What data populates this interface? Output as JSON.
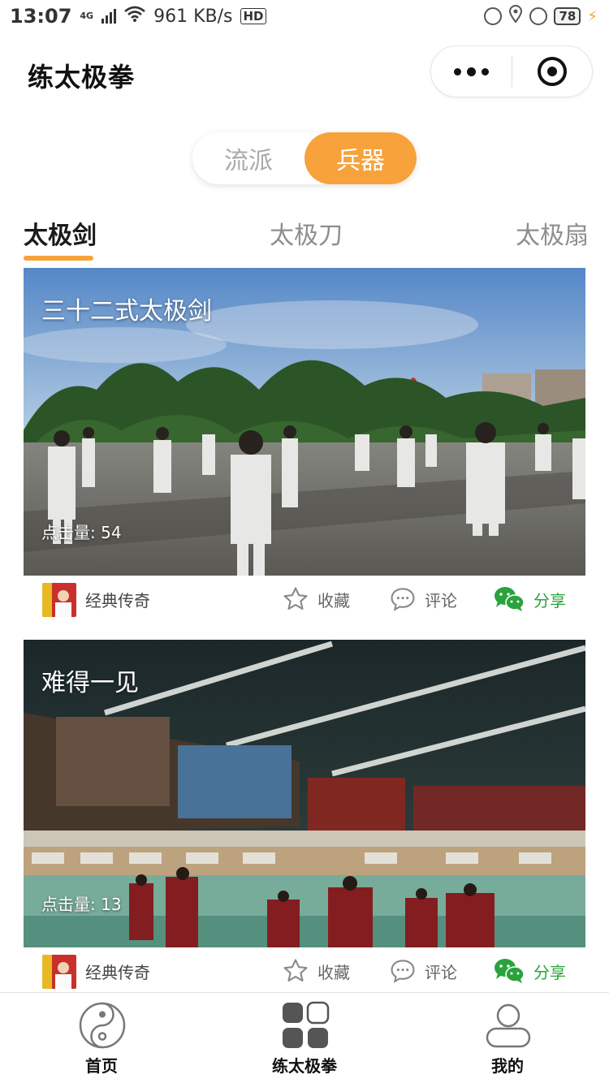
{
  "status_bar": {
    "time": "13:07",
    "network_type": "4G",
    "speed": "961 KB/s",
    "hd": "HD",
    "battery": "78"
  },
  "nav": {
    "title": "练太极拳"
  },
  "segment": {
    "options": [
      "流派",
      "兵器"
    ],
    "active_index": 1
  },
  "category_tabs": {
    "items": [
      "太极剑",
      "太极刀",
      "太极扇"
    ],
    "active_index": 0
  },
  "videos": [
    {
      "title": "三十二式太极剑",
      "clicks": "点击量: 54",
      "author": "经典传奇",
      "collect_label": "收藏",
      "comment_label": "评论",
      "share_label": "分享"
    },
    {
      "title": "难得一见",
      "clicks": "点击量: 13",
      "author": "经典传奇",
      "collect_label": "收藏",
      "comment_label": "评论",
      "share_label": "分享"
    }
  ],
  "tabbar": {
    "items": [
      {
        "label": "首页",
        "icon": "yin-yang-icon"
      },
      {
        "label": "练太极拳",
        "icon": "grid-icon"
      },
      {
        "label": "我的",
        "icon": "user-icon"
      }
    ],
    "active_index": 1
  },
  "colors": {
    "accent": "#f7a23a",
    "share_green": "#2aa33c",
    "tab_inactive": "#8e8e8e"
  }
}
